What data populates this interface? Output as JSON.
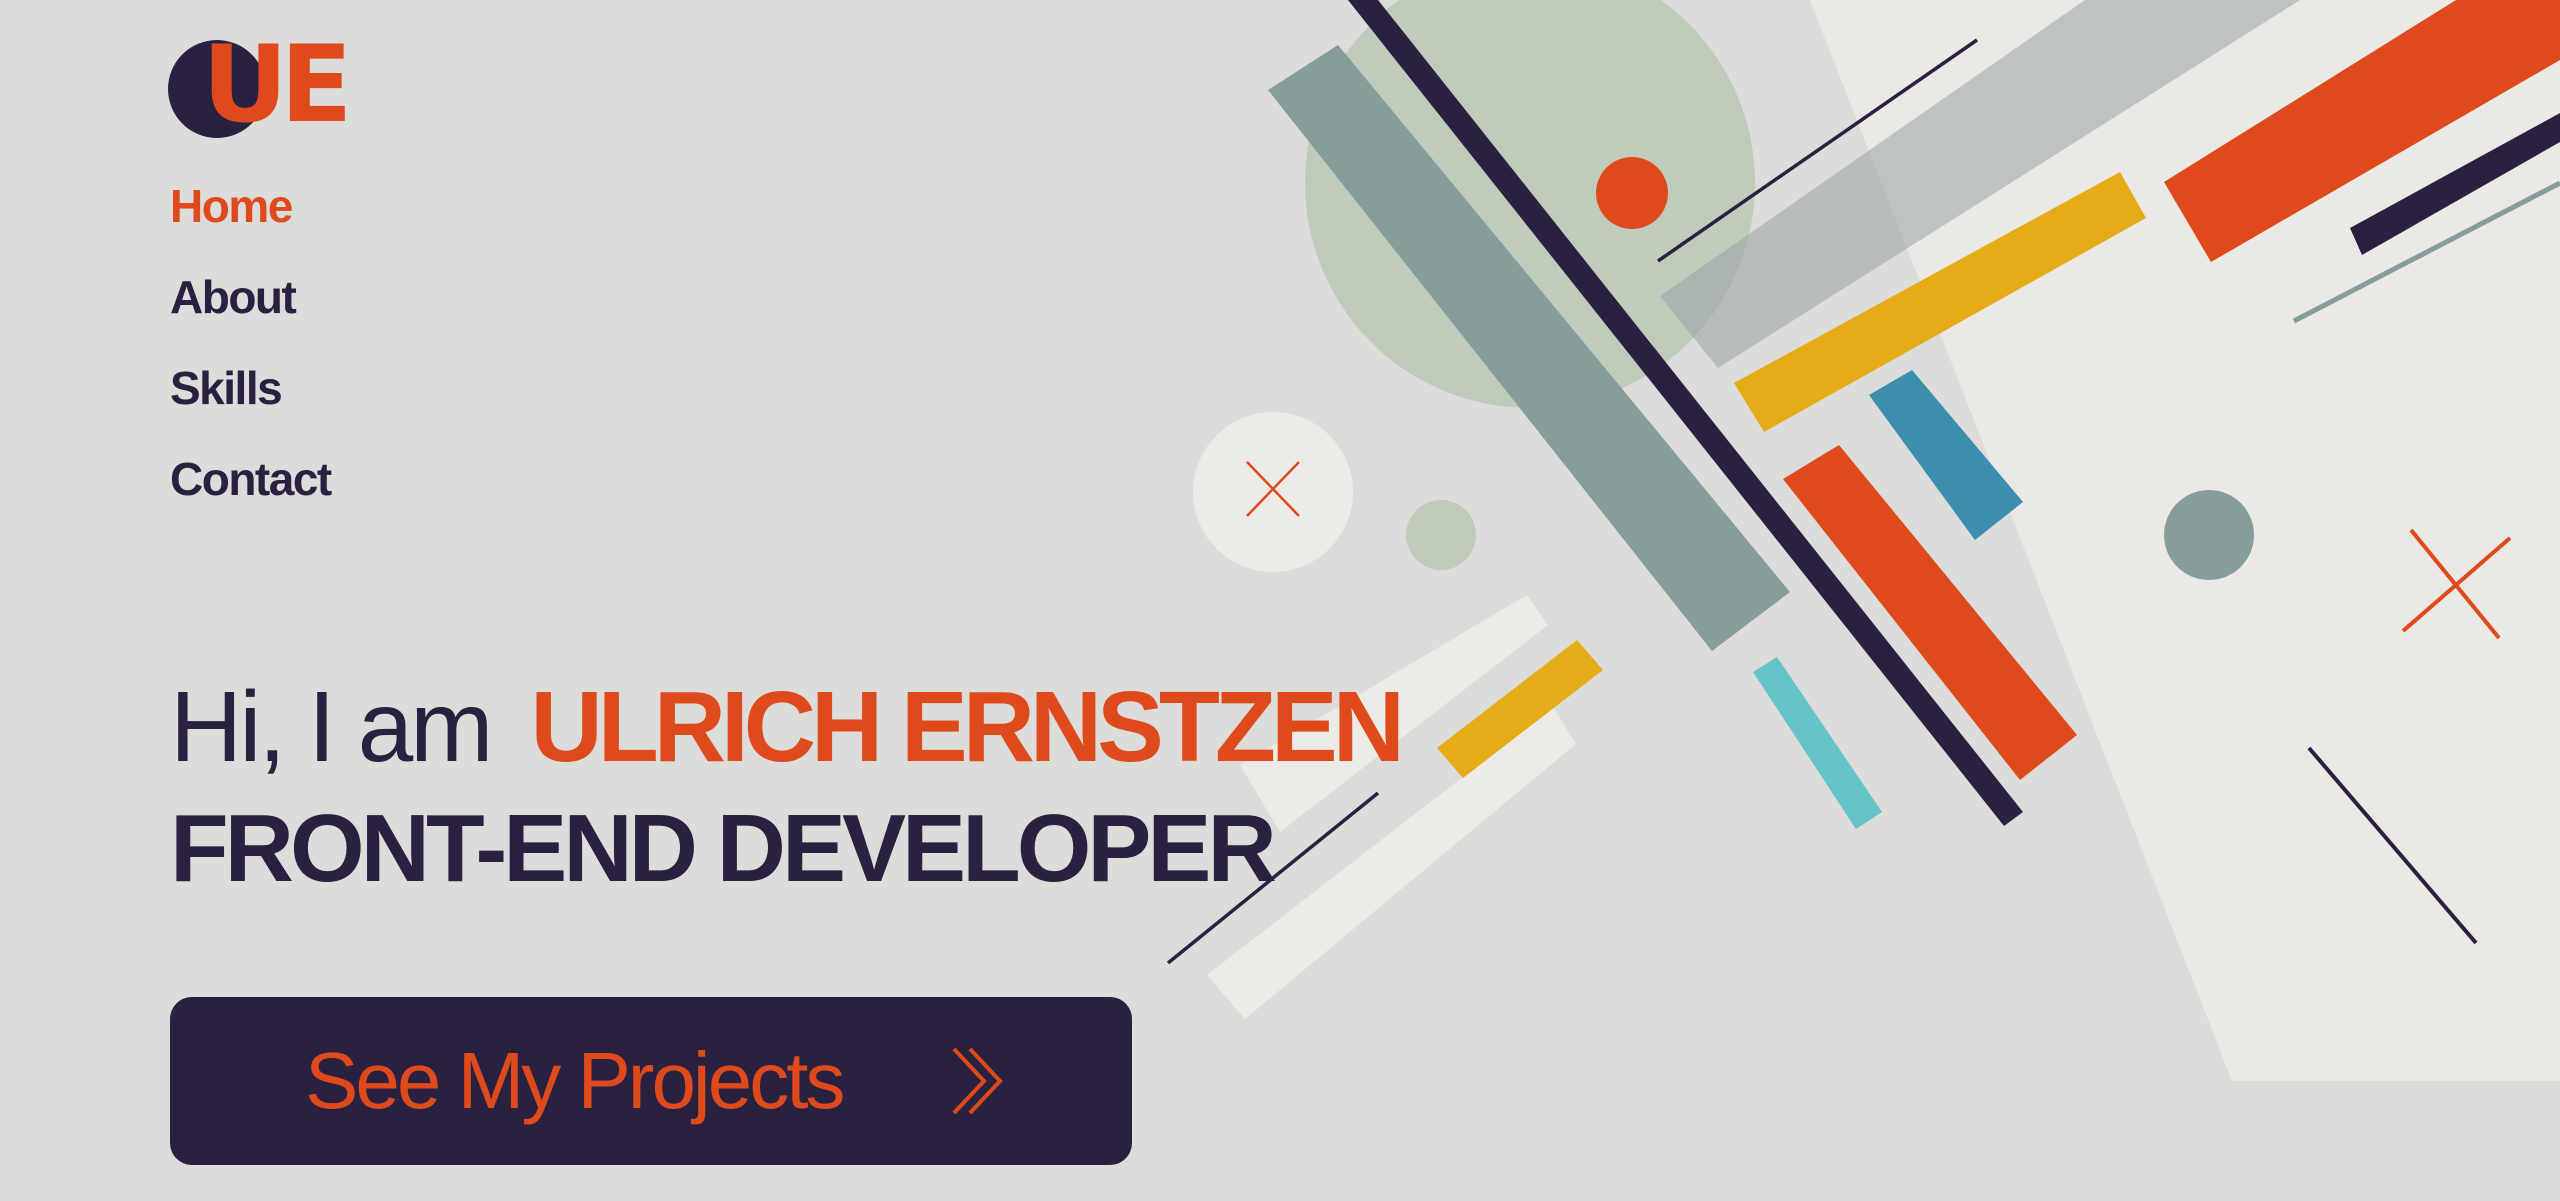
{
  "brand": {
    "logo_text": "UE",
    "colors": {
      "ink": "#2a2140",
      "accent": "#df4a1c",
      "background": "#dcdcda"
    }
  },
  "nav": {
    "items": [
      {
        "label": "Home",
        "active": true
      },
      {
        "label": "About"
      },
      {
        "label": "Skills"
      },
      {
        "label": "Contact"
      }
    ]
  },
  "hero": {
    "greeting": "Hi, I am",
    "name": "ULRICH ERNSTZEN",
    "role": "FRONT-END DEVELOPER"
  },
  "cta": {
    "label": "See My Projects",
    "icon": "double-chevron-right-icon"
  },
  "decoration": {
    "colors": [
      "#df4a1c",
      "#e6ac18",
      "#2a2140",
      "#3c8dae",
      "#64c4c8",
      "#869d9c",
      "#bfcbbb",
      "#eae9e6"
    ]
  }
}
